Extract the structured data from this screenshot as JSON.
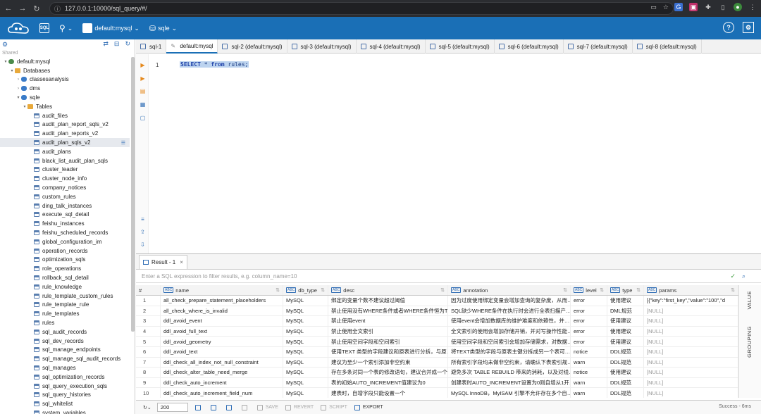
{
  "browser": {
    "url": "127.0.0.1:10000/sql_query/#/"
  },
  "header": {
    "connection": "default:mysql",
    "database": "sqle"
  },
  "nav": {
    "shared_label": "Shared",
    "root": "default:mysql",
    "databases_label": "Databases",
    "dbs": [
      "classesanalysis",
      "dms",
      "sqle"
    ],
    "tables_label": "Tables",
    "tables": [
      "audit_files",
      "audit_plan_report_sqls_v2",
      "audit_plan_reports_v2",
      "audit_plan_sqls_v2",
      "audit_plans",
      "black_list_audit_plan_sqls",
      "cluster_leader",
      "cluster_node_info",
      "company_notices",
      "custom_rules",
      "ding_talk_instances",
      "execute_sql_detail",
      "feishu_instances",
      "feishu_scheduled_records",
      "global_configuration_im",
      "operation_records",
      "optimization_sqls",
      "role_operations",
      "rollback_sql_detail",
      "rule_knowledge",
      "rule_template_custom_rules",
      "rule_template_rule",
      "rule_templates",
      "rules",
      "sql_audit_records",
      "sql_dev_records",
      "sql_manage_endpoints",
      "sql_manage_sql_audit_records",
      "sql_manages",
      "sql_optimization_records",
      "sql_query_execution_sqls",
      "sql_query_histories",
      "sql_whitelist",
      "system_variables"
    ]
  },
  "tabs": [
    "sql-1",
    "default:mysql",
    "sql-2 (default:mysql)",
    "sql-3 (default:mysql)",
    "sql-4 (default:mysql)",
    "sql-5 (default:mysql)",
    "sql-6 (default:mysql)",
    "sql-7 (default:mysql)",
    "sql-8 (default:mysql)"
  ],
  "editor": {
    "line": "1",
    "sql_kw1": "SELECT",
    "sql_mid": " * ",
    "sql_kw2": "from",
    "sql_tail": " rules;"
  },
  "results": {
    "tab_label": "Result - 1",
    "filter_placeholder": "Enter a SQL expression to filter results, e.g. column_name=10",
    "columns": [
      "#",
      "name",
      "db_type",
      "desc",
      "annotation",
      "level",
      "type",
      "params"
    ],
    "rows": [
      [
        "1",
        "all_check_prepare_statement_placeholders",
        "MySQL",
        "绑定的变量个数不建议超过阈值",
        "因为过度使用绑定变量会增加查询的复杂度，从而…",
        "error",
        "使用建议",
        "[{\"key\":\"first_key\",\"value\":\"100\",\"d"
      ],
      [
        "2",
        "all_check_where_is_invalid",
        "MySQL",
        "禁止使用没有WHERE条件或者WHERE条件恒为TR…",
        "SQL缺少WHERE条件在执行时会进行全表扫描产…",
        "error",
        "DML规范",
        "[NULL]"
      ],
      [
        "3",
        "ddl_avoid_event",
        "MySQL",
        "禁止使用event",
        "使用event会增加数据库的维护难度和依赖性，并…",
        "error",
        "使用建议",
        "[NULL]"
      ],
      [
        "4",
        "ddl_avoid_full_text",
        "MySQL",
        "禁止使用全文索引",
        "全文索引的使用会增加存储开销，并对写操作性能…",
        "error",
        "使用建议",
        "[NULL]"
      ],
      [
        "5",
        "ddl_avoid_geometry",
        "MySQL",
        "禁止使用空间字段和空间索引",
        "使用空间字段和空间索引会增加存储需求，对数据…",
        "error",
        "使用建议",
        "[NULL]"
      ],
      [
        "6",
        "ddl_avoid_text",
        "MySQL",
        "使用TEXT 类型的字段建议和原表进行分拆，与原…",
        "将TEXT类型的字段与原表主键分拆成另一个表可…",
        "notice",
        "DDL规范",
        "[NULL]"
      ],
      [
        "7",
        "ddl_check_all_index_not_null_constraint",
        "MySQL",
        "建议为至少一个索引添加非空约束",
        "所有索引字段均未做非空约束，请确认下表索引规…",
        "warn",
        "DDL规范",
        "[NULL]"
      ],
      [
        "8",
        "ddl_check_alter_table_need_merge",
        "MySQL",
        "存在多条对同一个表的修改语句，建议合并成一个…",
        "避免多次 TABLE REBUILD 带来的消耗，以及对线…",
        "notice",
        "使用建议",
        "[NULL]"
      ],
      [
        "9",
        "ddl_check_auto_increment",
        "MySQL",
        "表的初始AUTO_INCREMENT值建议为0",
        "创建表时AUTO_INCREMENT设置为0则自增从1开…",
        "warn",
        "DDL规范",
        "[NULL]"
      ],
      [
        "10",
        "ddl_check_auto_increment_field_num",
        "MySQL",
        "建表时，自增字段只能设置一个",
        "MySQL InnoDB，MyISAM 引擎不允许存在多个自…",
        "warn",
        "DDL规范",
        "[NULL]"
      ]
    ],
    "side_value": "VALUE",
    "side_grouping": "GROUPING"
  },
  "bottom": {
    "limit": "200",
    "save": "SAVE",
    "revert": "REVERT",
    "script": "SCRIPT",
    "export": "EXPORT",
    "status": "Success - 6ms"
  }
}
